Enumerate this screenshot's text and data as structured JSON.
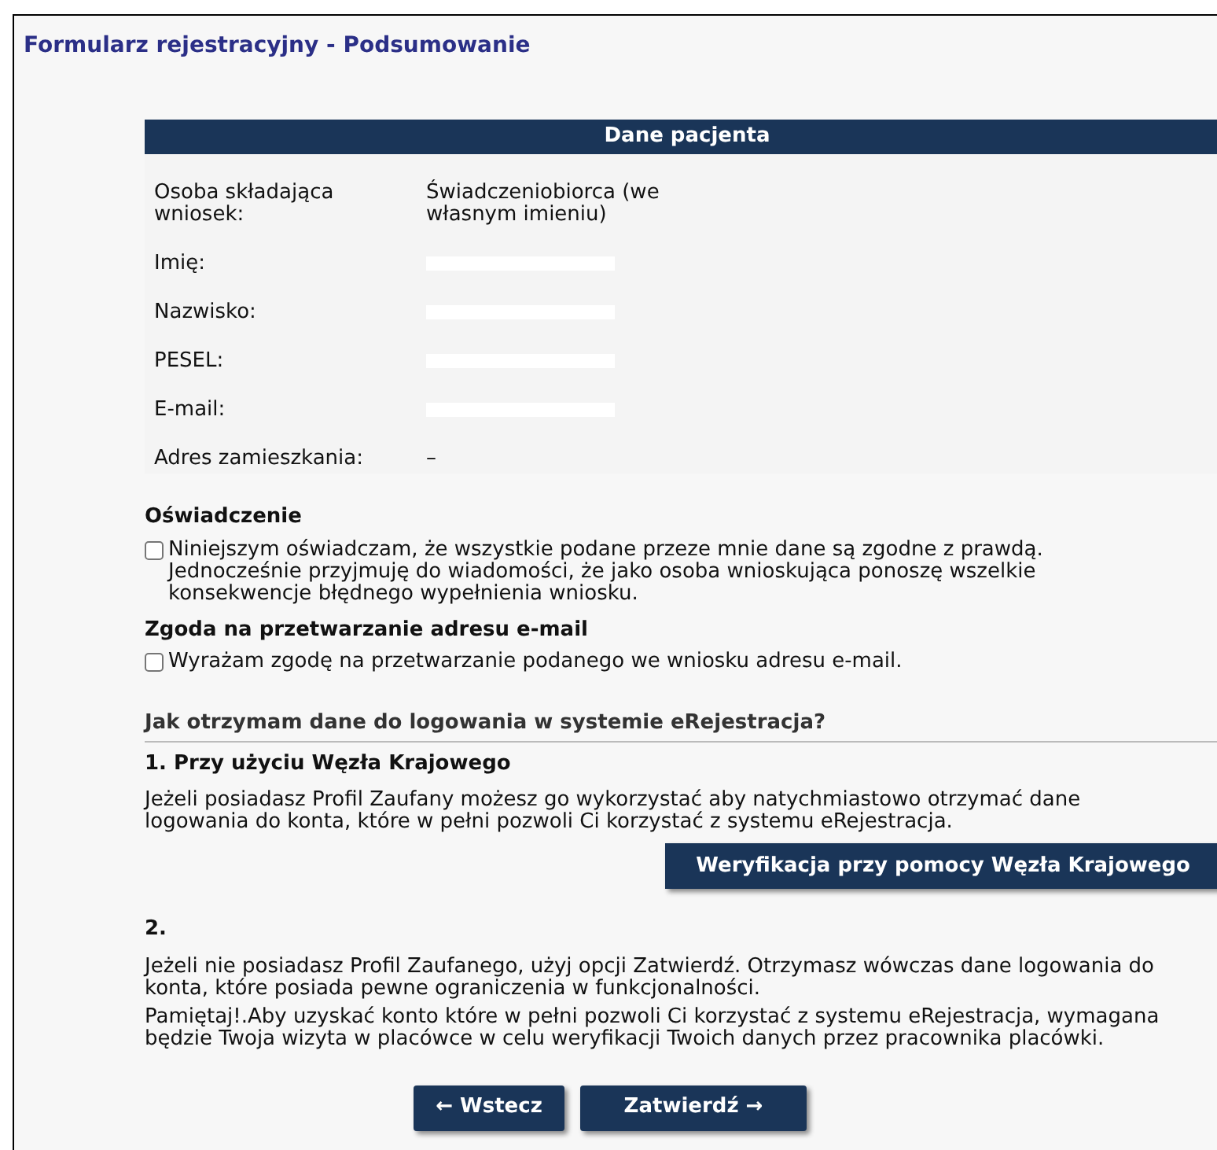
{
  "title": "Formularz rejestracyjny - Podsumowanie",
  "patient": {
    "header": "Dane pacjenta",
    "rows": [
      {
        "label": "Osoba składająca wniosek:",
        "value": "Świadczeniobiorca (we własnym imieniu)",
        "redacted": false
      },
      {
        "label": "Imię:",
        "redacted": true
      },
      {
        "label": "Nazwisko:",
        "redacted": true
      },
      {
        "label": "PESEL:",
        "redacted": true
      },
      {
        "label": "E-mail:",
        "redacted": true
      },
      {
        "label": "Adres zamieszkania:",
        "value": "–",
        "redacted": false
      }
    ]
  },
  "consents": [
    {
      "heading": "Oświadczenie",
      "text": "Niniejszym oświadczam, że wszystkie podane przeze mnie dane są zgodne z prawdą. Jednocześnie przyjmuję do wiadomości, że jako osoba wnioskująca ponoszę wszelkie konsekwencje błędnego wypełnienia wniosku.",
      "checked": false
    },
    {
      "heading": "Zgoda na przetwarzanie adresu e-mail",
      "text": "Wyrażam zgodę na przetwarzanie podanego we wniosku adresu e-mail.",
      "checked": false
    }
  ],
  "login_info": {
    "heading": "Jak otrzymam dane do logowania w systemie eRejestracja?",
    "options": [
      {
        "title": "1. Przy użyciu Węzła Krajowego",
        "paragraphs": [
          "Jeżeli posiadasz Profil Zaufany możesz go wykorzystać aby natychmiastowo otrzymać dane logowania do konta, które w pełni pozwoli Ci korzystać z systemu eRejestracja."
        ],
        "button": "Weryfikacja przy pomocy Węzła Krajowego"
      },
      {
        "title": "2.",
        "paragraphs": [
          "Jeżeli nie posiadasz Profil Zaufanego, użyj opcji Zatwierdź. Otrzymasz wówczas dane logowania do konta, które posiada pewne ograniczenia w funkcjonalności.",
          "Pamiętaj!.Aby uzyskać konto które w pełni pozwoli Ci korzystać z systemu eRejestracja, wymagana będzie Twoja wizyta w placówce w celu weryfikacji Twoich danych przez pracownika placówki."
        ]
      }
    ]
  },
  "buttons": [
    {
      "label": "← Wstecz"
    },
    {
      "label": "Zatwierdź →"
    }
  ]
}
